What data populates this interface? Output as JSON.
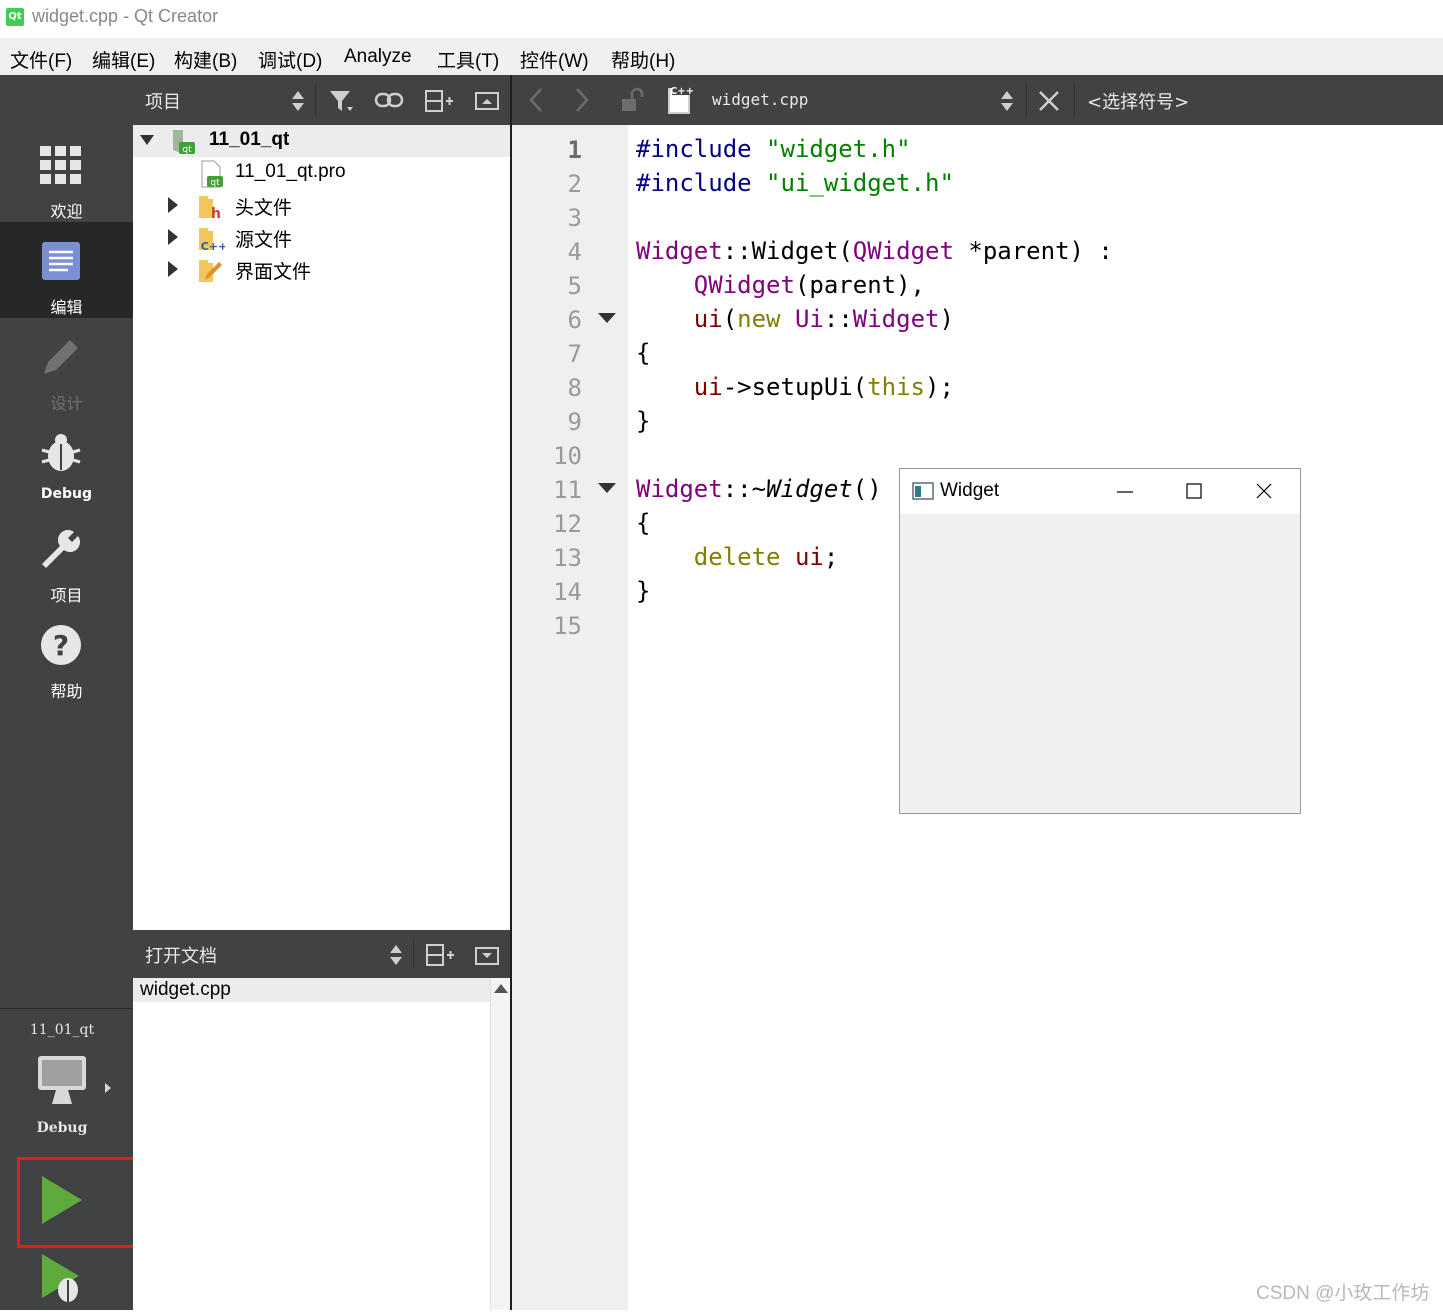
{
  "window": {
    "title": "widget.cpp - Qt Creator",
    "logo_text": "Qt"
  },
  "menubar": {
    "items": [
      "文件(F)",
      "编辑(E)",
      "构建(B)",
      "调试(D)",
      "Analyze",
      "工具(T)",
      "控件(W)",
      "帮助(H)"
    ]
  },
  "modes": [
    {
      "label": "欢迎",
      "icon": "grid-icon",
      "state": "normal"
    },
    {
      "label": "编辑",
      "icon": "edit-doc-icon",
      "state": "active"
    },
    {
      "label": "设计",
      "icon": "pencil-icon",
      "state": "disabled"
    },
    {
      "label": "Debug",
      "icon": "bug-icon",
      "state": "normal"
    },
    {
      "label": "项目",
      "icon": "wrench-icon",
      "state": "normal"
    },
    {
      "label": "帮助",
      "icon": "help-icon",
      "state": "normal"
    }
  ],
  "kit": {
    "project": "11_01_qt",
    "build": "Debug"
  },
  "navigator": {
    "title": "项目",
    "tree": {
      "root": "11_01_qt",
      "pro_file": "11_01_qt.pro",
      "folders": [
        "头文件",
        "源文件",
        "界面文件"
      ]
    }
  },
  "open_docs": {
    "title": "打开文档",
    "files": [
      "widget.cpp"
    ]
  },
  "editor": {
    "filename": "widget.cpp",
    "symbol_placeholder": "<选择符号>",
    "current_line": "1",
    "line_numbers": [
      "1",
      "2",
      "3",
      "4",
      "5",
      "6",
      "7",
      "8",
      "9",
      "10",
      "11",
      "12",
      "13",
      "14",
      "15"
    ],
    "code": {
      "l1_pp": "#include",
      "l1_str": "\"widget.h\"",
      "l2_pp": "#include",
      "l2_str": "\"ui_widget.h\"",
      "l4_a": "Widget",
      "l4_b": "::",
      "l4_c": "Widget",
      "l4_d": "(",
      "l4_e": "QWidget",
      "l4_f": " *parent) :",
      "l5_a": "QWidget",
      "l5_b": "(parent),",
      "l6_a": "ui",
      "l6_b": "(",
      "l6_c": "new",
      "l6_d": " ",
      "l6_e": "Ui",
      "l6_f": "::",
      "l6_g": "Widget",
      "l6_h": ")",
      "l7": "{",
      "l8_a": "ui",
      "l8_b": "->setupUi(",
      "l8_c": "this",
      "l8_d": ");",
      "l9": "}",
      "l11_a": "Widget",
      "l11_b": "::~",
      "l11_c": "Widget",
      "l11_d": "()",
      "l12": "{",
      "l13_a": "delete",
      "l13_b": " ",
      "l13_c": "ui",
      "l13_d": ";",
      "l14": "}"
    }
  },
  "widget_window": {
    "title": "Widget"
  },
  "watermark": "CSDN @小玫工作坊",
  "colors": {
    "highlight_box": "#e02020",
    "run_green": "#5faa3c"
  }
}
